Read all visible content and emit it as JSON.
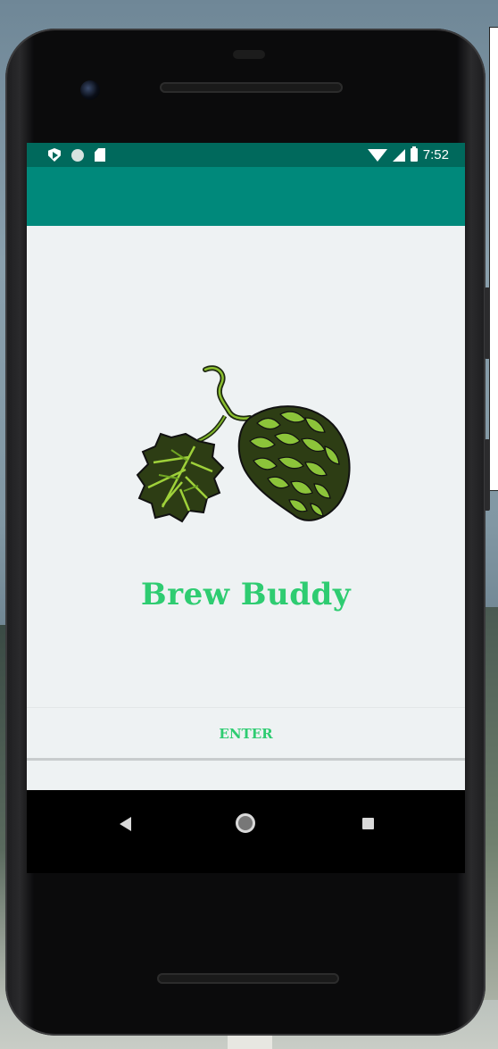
{
  "status_bar": {
    "time": "7:52",
    "icons_left": [
      "play-protect-icon",
      "notification-dot-icon",
      "sd-card-icon"
    ],
    "icons_right": [
      "wifi-icon",
      "signal-icon",
      "battery-icon"
    ]
  },
  "app": {
    "name": "Brew Buddy",
    "logo": "hops-illustration",
    "enter_label": "ENTER"
  },
  "navigation": {
    "buttons": [
      "back",
      "home",
      "recents"
    ]
  },
  "colors": {
    "status_bar": "#00695c",
    "app_bar": "#00897b",
    "brand_green": "#2ecc71",
    "background": "#eef2f3"
  }
}
